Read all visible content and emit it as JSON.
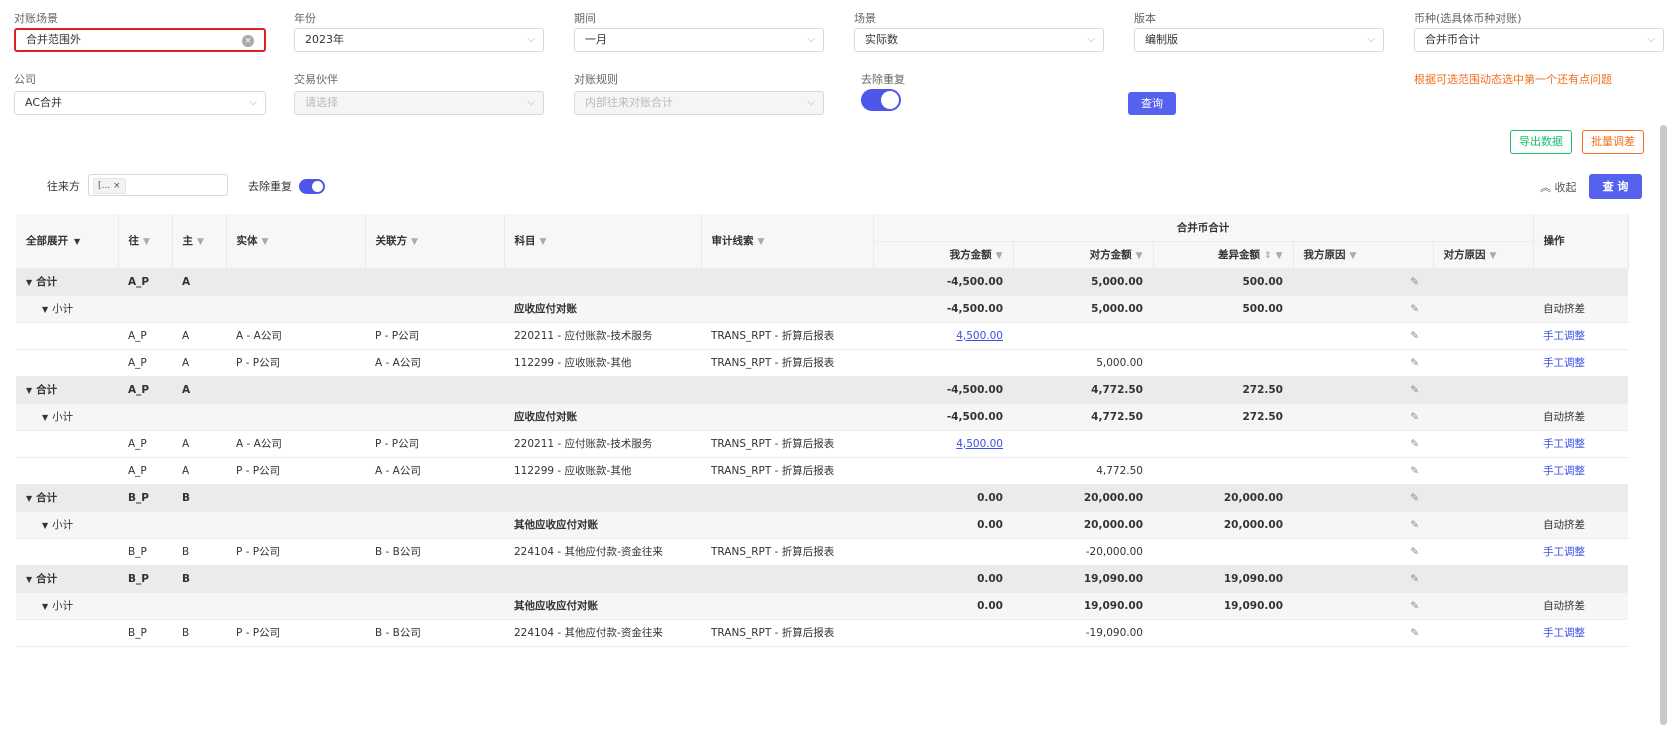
{
  "filters": {
    "scene_label": "对账场景",
    "scene_value": "合并范围外",
    "year_label": "年份",
    "year_value": "2023年",
    "period_label": "期间",
    "period_value": "一月",
    "scenario_label": "场景",
    "scenario_value": "实际数",
    "version_label": "版本",
    "version_value": "编制版",
    "currency_label": "币种(选具体币种对账)",
    "currency_value": "合并币合计",
    "company_label": "公司",
    "company_value": "AC合并",
    "partner_label": "交易伙伴",
    "partner_placeholder": "请选择",
    "rule_label": "对账规则",
    "rule_value": "内部往来对账合计",
    "dedup_label": "去除重复",
    "query_button": "查询",
    "warning_text": "根据可选范围动态选中第一个还有点问题"
  },
  "toolbar": {
    "export_button": "导出数据",
    "batch_button": "批量调差",
    "counterparty_label": "往来方",
    "counterparty_tag": "[...",
    "dedup_label": "去除重复",
    "collapse_label": "收起",
    "query_button": "查 询"
  },
  "table": {
    "group_header": "合并币合计",
    "headers": [
      "全部展开",
      "往",
      "主",
      "实体",
      "关联方",
      "科目",
      "审计线索",
      "我方金额",
      "对方金额",
      "差异金额",
      "我方原因",
      "对方原因",
      "操作"
    ],
    "rows": [
      {
        "type": "total",
        "c0": "合计",
        "wang": "A_P",
        "zhu": "A",
        "entity": "",
        "related": "",
        "account": "",
        "audit": "",
        "ours": "-4,500.00",
        "theirs": "5,000.00",
        "diff": "500.00",
        "op": ""
      },
      {
        "type": "sub",
        "c0": "小计",
        "wang": "",
        "zhu": "",
        "entity": "",
        "related": "",
        "account": "应收应付对账",
        "audit": "",
        "ours": "-4,500.00",
        "theirs": "5,000.00",
        "diff": "500.00",
        "op": "自动挤差"
      },
      {
        "type": "detail",
        "c0": "",
        "wang": "A_P",
        "zhu": "A",
        "entity": "A - A公司",
        "related": "P - P公司",
        "account": "220211 - 应付账款-技术服务",
        "audit": "TRANS_RPT - 折算后报表",
        "ours": "4,500.00",
        "theirs": "",
        "diff": "",
        "op": "手工调整"
      },
      {
        "type": "detail",
        "c0": "",
        "wang": "A_P",
        "zhu": "A",
        "entity": "P - P公司",
        "related": "A - A公司",
        "account": "112299 - 应收账款-其他",
        "audit": "TRANS_RPT - 折算后报表",
        "ours": "",
        "theirs": "5,000.00",
        "diff": "",
        "op": "手工调整"
      },
      {
        "type": "total",
        "c0": "合计",
        "wang": "A_P",
        "zhu": "A",
        "entity": "",
        "related": "",
        "account": "",
        "audit": "",
        "ours": "-4,500.00",
        "theirs": "4,772.50",
        "diff": "272.50",
        "op": ""
      },
      {
        "type": "sub",
        "c0": "小计",
        "wang": "",
        "zhu": "",
        "entity": "",
        "related": "",
        "account": "应收应付对账",
        "audit": "",
        "ours": "-4,500.00",
        "theirs": "4,772.50",
        "diff": "272.50",
        "op": "自动挤差"
      },
      {
        "type": "detail",
        "c0": "",
        "wang": "A_P",
        "zhu": "A",
        "entity": "A - A公司",
        "related": "P - P公司",
        "account": "220211 - 应付账款-技术服务",
        "audit": "TRANS_RPT - 折算后报表",
        "ours": "4,500.00",
        "theirs": "",
        "diff": "",
        "op": "手工调整"
      },
      {
        "type": "detail",
        "c0": "",
        "wang": "A_P",
        "zhu": "A",
        "entity": "P - P公司",
        "related": "A - A公司",
        "account": "112299 - 应收账款-其他",
        "audit": "TRANS_RPT - 折算后报表",
        "ours": "",
        "theirs": "4,772.50",
        "diff": "",
        "op": "手工调整"
      },
      {
        "type": "total",
        "c0": "合计",
        "wang": "B_P",
        "zhu": "B",
        "entity": "",
        "related": "",
        "account": "",
        "audit": "",
        "ours": "0.00",
        "theirs": "20,000.00",
        "diff": "20,000.00",
        "op": ""
      },
      {
        "type": "sub",
        "c0": "小计",
        "wang": "",
        "zhu": "",
        "entity": "",
        "related": "",
        "account": "其他应收应付对账",
        "audit": "",
        "ours": "0.00",
        "theirs": "20,000.00",
        "diff": "20,000.00",
        "op": "自动挤差"
      },
      {
        "type": "detail",
        "c0": "",
        "wang": "B_P",
        "zhu": "B",
        "entity": "P - P公司",
        "related": "B - B公司",
        "account": "224104 - 其他应付款-资金往来",
        "audit": "TRANS_RPT - 折算后报表",
        "ours": "",
        "theirs": "-20,000.00",
        "diff": "",
        "op": "手工调整"
      },
      {
        "type": "total",
        "c0": "合计",
        "wang": "B_P",
        "zhu": "B",
        "entity": "",
        "related": "",
        "account": "",
        "audit": "",
        "ours": "0.00",
        "theirs": "19,090.00",
        "diff": "19,090.00",
        "op": ""
      },
      {
        "type": "sub",
        "c0": "小计",
        "wang": "",
        "zhu": "",
        "entity": "",
        "related": "",
        "account": "其他应收应付对账",
        "audit": "",
        "ours": "0.00",
        "theirs": "19,090.00",
        "diff": "19,090.00",
        "op": "自动挤差"
      },
      {
        "type": "detail",
        "c0": "",
        "wang": "B_P",
        "zhu": "B",
        "entity": "P - P公司",
        "related": "B - B公司",
        "account": "224104 - 其他应付款-资金往来",
        "audit": "TRANS_RPT - 折算后报表",
        "ours": "",
        "theirs": "-19,090.00",
        "diff": "",
        "op": "手工调整"
      }
    ]
  },
  "colors": {
    "accent": "#5462ee",
    "warning": "#f07020",
    "export": "#19be6b",
    "batch": "#f07020",
    "highlight_border": "#e02020"
  }
}
